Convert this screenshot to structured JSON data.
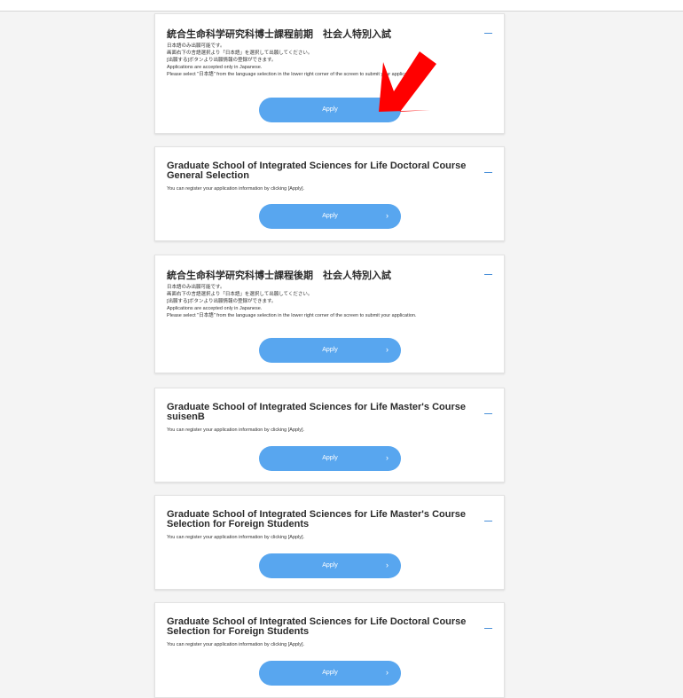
{
  "colors": {
    "accent": "#58a6ef",
    "annotation_arrow": "#ff0000",
    "collapse_icon": "#4a90d9"
  },
  "cards": [
    {
      "title": "統合生命科学研究科博士課程前期　社会人特別入試",
      "desc": [
        "日本語のみ出願可能です。",
        "画面右下の言語選択より「日本語」を選択して出願してください。",
        "[出願する]ボタンより出願情報の登録ができます。",
        "Applications are accepted only in Japanese.",
        "Please select \"日本語\" from the language selection in the lower right corner of the screen to submit your application."
      ],
      "apply_label": "Apply",
      "chevron": "›"
    },
    {
      "title": "Graduate School of Integrated Sciences for Life Doctoral Course General Selection",
      "desc": [
        "You can register your application information by clicking [Apply]."
      ],
      "apply_label": "Apply",
      "chevron": "›"
    },
    {
      "title": "統合生命科学研究科博士課程後期　社会人特別入試",
      "desc": [
        "日本語のみ出願可能です。",
        "画面右下の言語選択より「日本語」を選択して出願してください。",
        "[出願する]ボタンより出願情報の登録ができます。",
        "Applications are accepted only in Japanese.",
        "Please select \"日本語\" from the language selection in the lower right corner of the screen to submit your application."
      ],
      "apply_label": "Apply",
      "chevron": "›"
    },
    {
      "title": "Graduate School of Integrated Sciences for Life Master's Course suisenB",
      "desc": [
        "You can register your application information by clicking [Apply]."
      ],
      "apply_label": "Apply",
      "chevron": "›"
    },
    {
      "title": "Graduate School of Integrated Sciences for Life Master's Course Selection for Foreign Students",
      "desc": [
        "You can register your application information by clicking [Apply]."
      ],
      "apply_label": "Apply",
      "chevron": "›"
    },
    {
      "title": "Graduate School of Integrated Sciences for Life Doctoral Course Selection for Foreign Students",
      "desc": [
        "You can register your application information by clicking [Apply]."
      ],
      "apply_label": "Apply",
      "chevron": "›"
    }
  ]
}
